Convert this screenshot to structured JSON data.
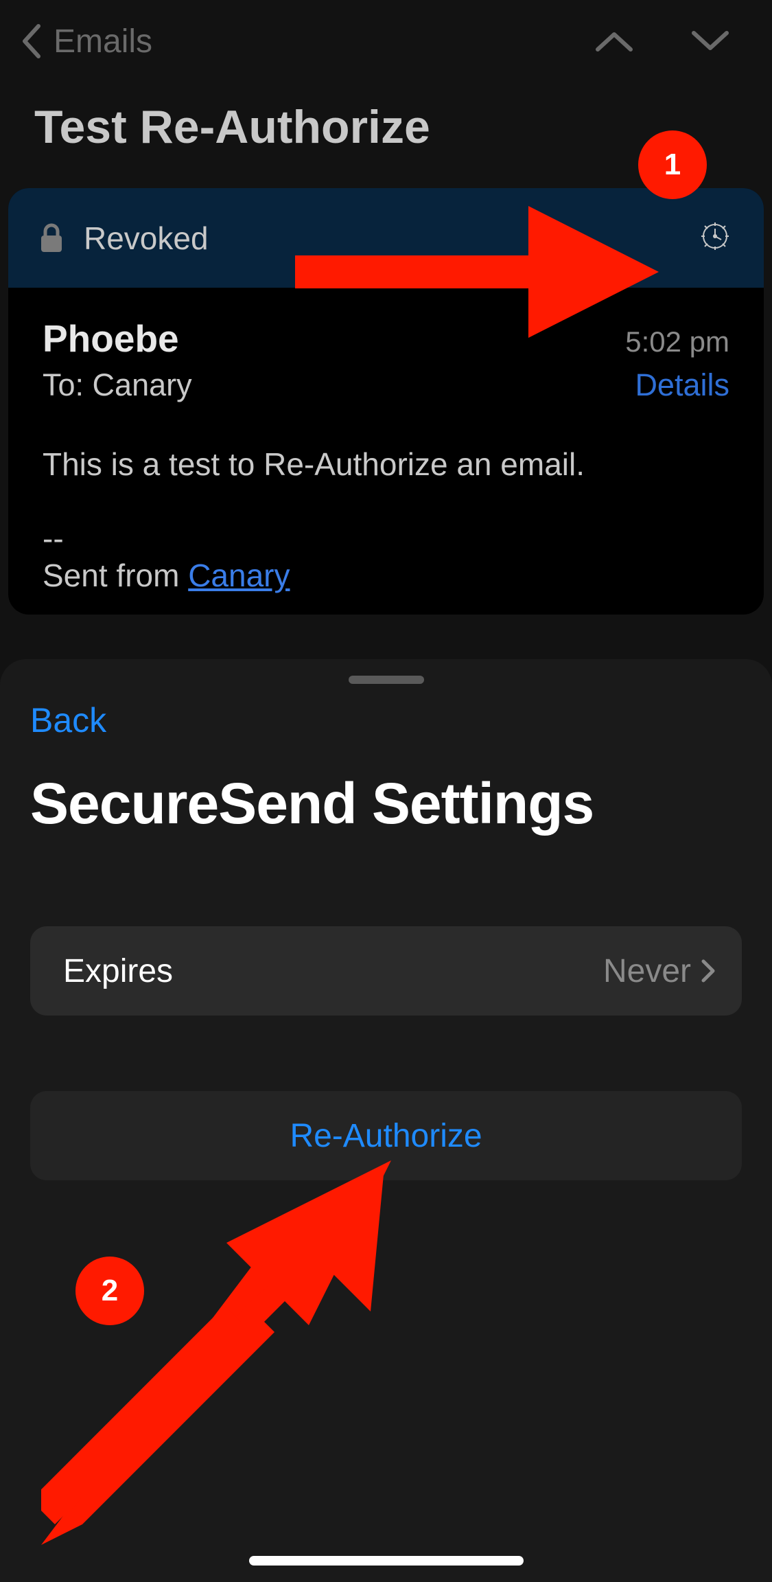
{
  "nav": {
    "back_label": "Emails"
  },
  "page": {
    "title": "Test Re-Authorize"
  },
  "banner": {
    "status": "Revoked"
  },
  "message": {
    "sender": "Phoebe",
    "time": "5:02 pm",
    "to_prefix": "To: ",
    "to_name": "Canary",
    "details_label": "Details",
    "body": "This is a test to Re-Authorize an email.",
    "sig_dashes": "--",
    "sig_prefix": "Sent from ",
    "sig_link": "Canary"
  },
  "sheet": {
    "back_label": "Back",
    "title": "SecureSend Settings",
    "expires_label": "Expires",
    "expires_value": "Never",
    "action_label": "Re-Authorize"
  },
  "annotations": {
    "badge1": "1",
    "badge2": "2"
  }
}
